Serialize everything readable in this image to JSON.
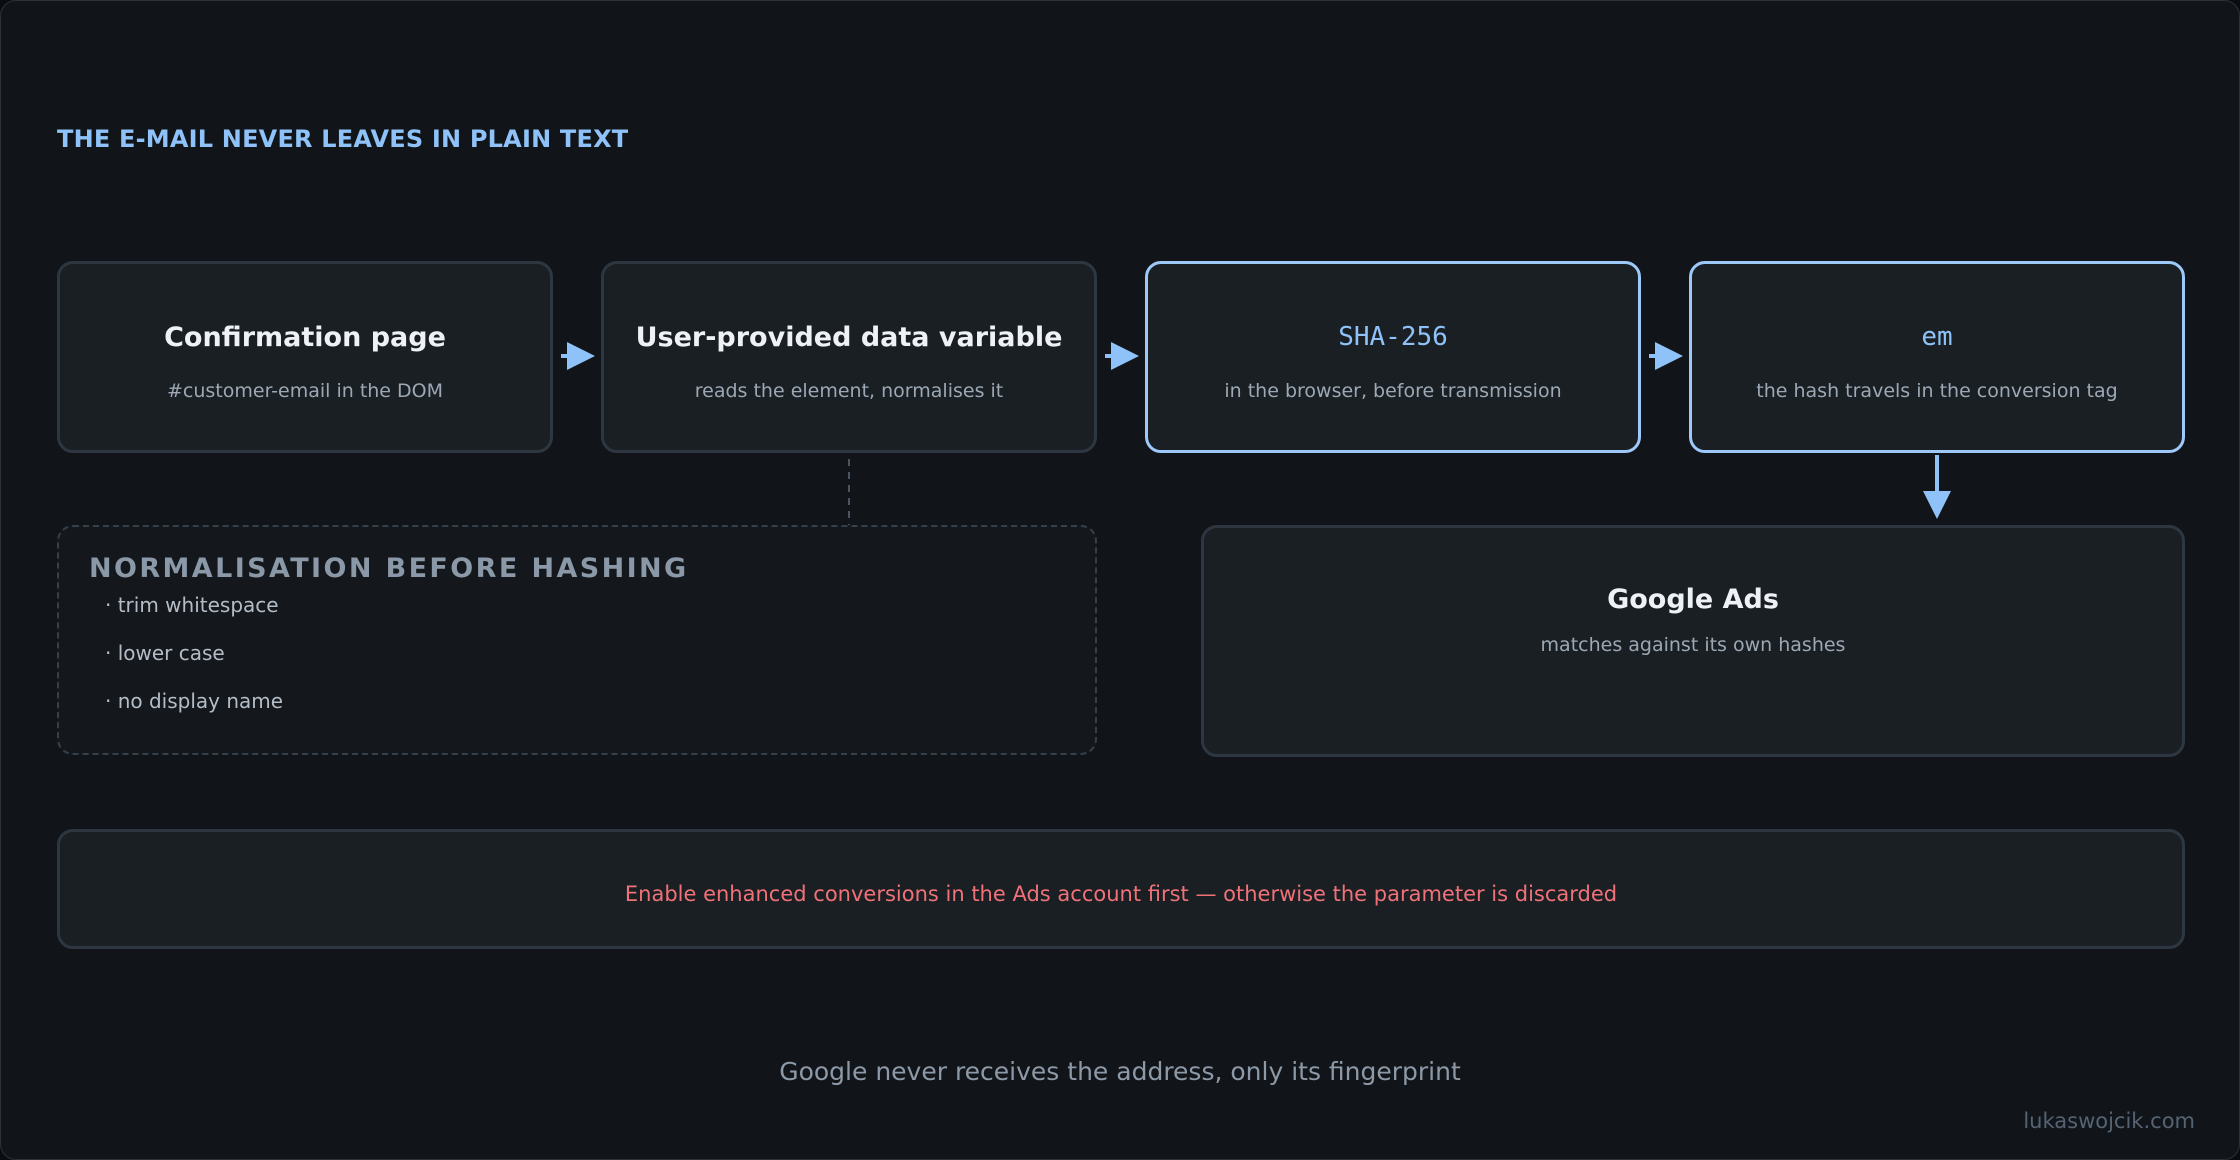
{
  "header": {
    "title": "THE E-MAIL NEVER LEAVES IN PLAIN TEXT"
  },
  "flow": [
    {
      "title": "Confirmation page",
      "subtitle": "#customer-email in the DOM"
    },
    {
      "title": "User-provided data variable",
      "subtitle": "reads the element, normalises it"
    },
    {
      "title": "SHA-256",
      "subtitle": "in the browser, before transmission"
    },
    {
      "title": "em",
      "subtitle": "the hash travels in the conversion tag"
    }
  ],
  "normalisation": {
    "title": "NORMALISATION BEFORE HASHING",
    "items": [
      "· trim whitespace",
      "· lower case",
      "· no display name"
    ]
  },
  "destination": {
    "title": "Google Ads",
    "subtitle": "matches against its own hashes"
  },
  "warning": {
    "text": "Enable enhanced conversions in the Ads account first — otherwise the parameter is discarded"
  },
  "footer": {
    "caption": "Google never receives the address, only its fingerprint",
    "credit": "lukaswojcik.com"
  },
  "colors": {
    "background": "#111519",
    "accent": "#8ec2f8",
    "box_fill": "#1a1f24",
    "box_border": "#2e3741",
    "highlight_border": "#9cc9f7",
    "warning": "#f07178"
  }
}
